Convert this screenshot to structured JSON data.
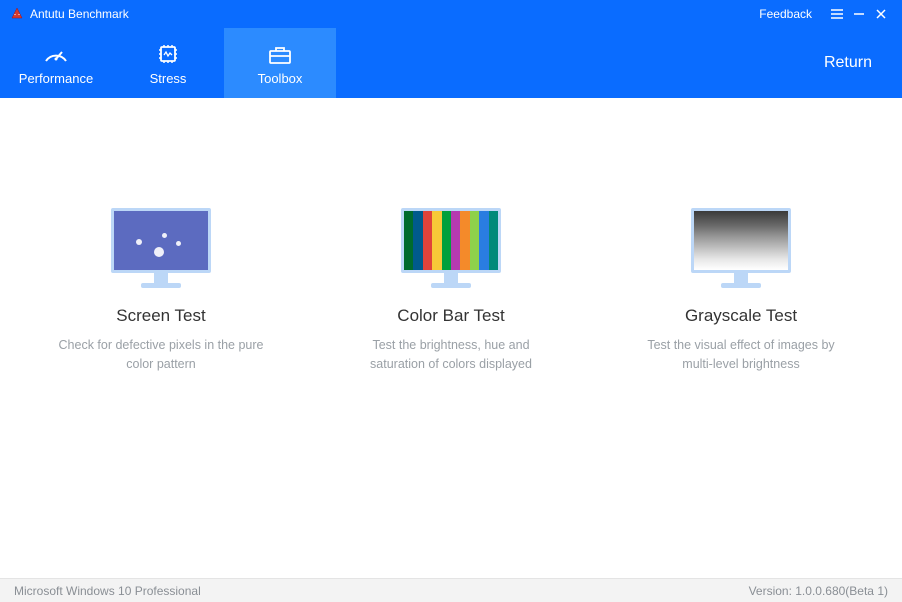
{
  "titlebar": {
    "title": "Antutu Benchmark",
    "feedback": "Feedback"
  },
  "nav": {
    "tabs": [
      {
        "label": "Performance",
        "active": false
      },
      {
        "label": "Stress",
        "active": false
      },
      {
        "label": "Toolbox",
        "active": true
      }
    ],
    "return_label": "Return"
  },
  "cards": [
    {
      "id": "screen-test",
      "title": "Screen Test",
      "description": "Check for defective pixels in the pure color pattern"
    },
    {
      "id": "color-bar-test",
      "title": "Color Bar Test",
      "description": "Test the brightness, hue and saturation of colors displayed"
    },
    {
      "id": "grayscale-test",
      "title": "Grayscale Test",
      "description": "Test the visual effect of images by multi-level brightness"
    }
  ],
  "statusbar": {
    "os": "Microsoft Windows 10 Professional",
    "version": "Version: 1.0.0.680(Beta 1)"
  },
  "colors": {
    "primary": "#0a6cff",
    "primary_active": "#2c8bff",
    "text_muted": "#9aa0a6",
    "monitor_frame": "#bcd7f7"
  }
}
